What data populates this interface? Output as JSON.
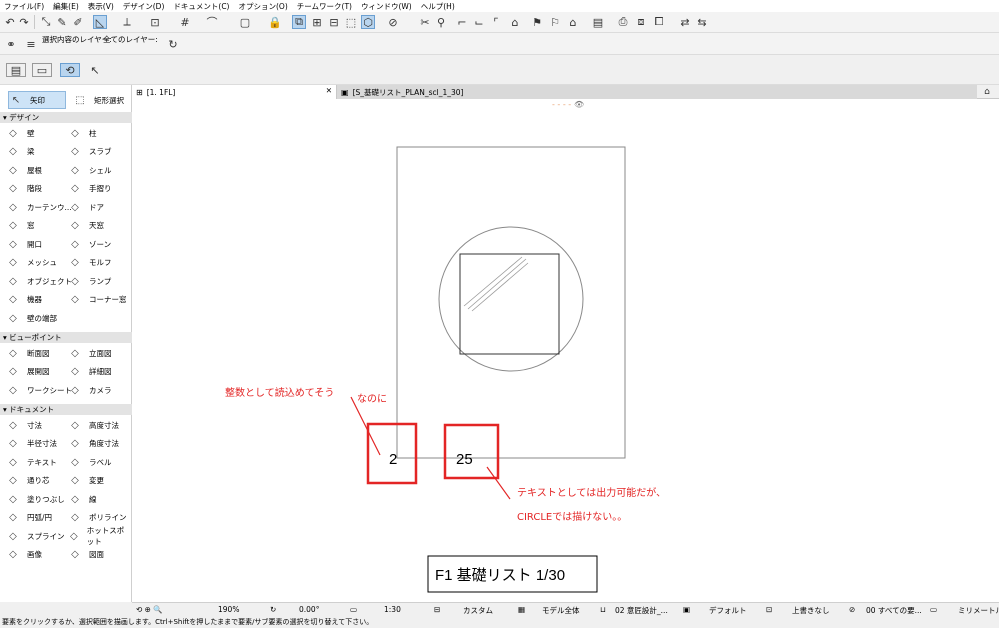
{
  "menu": [
    "ファイル(F)",
    "編集(E)",
    "表示(V)",
    "デザイン(D)",
    "ドキュメント(C)",
    "オプション(O)",
    "チームワーク(T)",
    "ウィンドウ(W)",
    "ヘルプ(H)"
  ],
  "infobox": {
    "layer_label": "選択内容のレイヤー:",
    "layer_all": "全てのレイヤー:"
  },
  "toolbox": {
    "arrow": "矢印",
    "marquee": "矩形選択",
    "sections": {
      "design": "デザイン",
      "viewpoint": "ビューポイント",
      "document": "ドキュメント"
    },
    "design_tools": [
      [
        "壁",
        "柱"
      ],
      [
        "梁",
        "スラブ"
      ],
      [
        "屋根",
        "シェル"
      ],
      [
        "階段",
        "手摺り"
      ],
      [
        "カーテンウ...",
        "ドア"
      ],
      [
        "窓",
        "天窓"
      ],
      [
        "開口",
        "ゾーン"
      ],
      [
        "メッシュ",
        "モルフ"
      ],
      [
        "オブジェクト",
        "ランプ"
      ],
      [
        "機器",
        "コーナー窓"
      ],
      [
        "壁の端部",
        ""
      ]
    ],
    "viewpoint_tools": [
      [
        "断面図",
        "立面図"
      ],
      [
        "展開図",
        "詳細図"
      ],
      [
        "ワークシート",
        "カメラ"
      ]
    ],
    "document_tools": [
      [
        "寸法",
        "高度寸法"
      ],
      [
        "半径寸法",
        "角度寸法"
      ],
      [
        "テキスト",
        "ラベル"
      ],
      [
        "通り芯",
        "変更"
      ],
      [
        "塗りつぶし",
        "線"
      ],
      [
        "円弧/円",
        "ポリライン"
      ],
      [
        "スプライン",
        "ホットスポット"
      ],
      [
        "画像",
        "図面"
      ]
    ]
  },
  "tabs": {
    "tab1": "[1. 1FL]",
    "tab2": "[S_基礎リスト_PLAN_scl_1_30]"
  },
  "drawing": {
    "num_small": "2",
    "num_large": "25",
    "annot_1": "整数として読込めてそう",
    "annot_2": "なのに",
    "annot_3": "テキストとしては出力可能だが、",
    "annot_4": "CIRCLEでは描けない。。",
    "title_box": "F1 基礎リスト 1/30"
  },
  "status": {
    "zoom": "190%",
    "angle": "0.00°",
    "scale": "1:30",
    "layer_combo": "カスタム",
    "model": "モデル全体",
    "design_opt": "02 意匠設計_...",
    "pen_set": "デフォルト",
    "override": "上書きなし",
    "renovation": "00 すべての要...",
    "unit": "ミリメートル"
  },
  "message": "要素をクリックするか、選択範囲を描画します。Ctrl+Shiftを押したままで要素/サブ要素の選択を切り替えて下さい。",
  "colors": {
    "annotation": "#e32525",
    "highlight": "#b9d5ef"
  }
}
